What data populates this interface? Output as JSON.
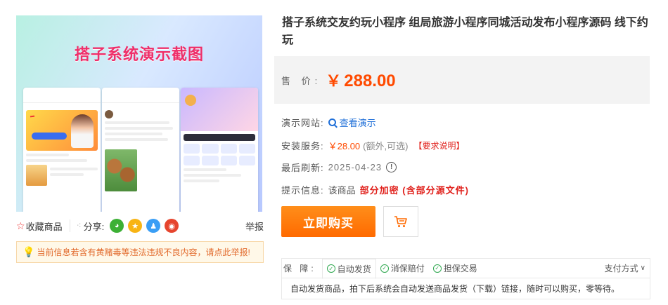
{
  "product_image": {
    "headline": "搭子系统演示截图"
  },
  "left_actions": {
    "favorite_label": "收藏商品",
    "share_label": "分享:",
    "report_label": "举报",
    "share_icons": [
      "wechat-icon",
      "qzone-icon",
      "qq-icon",
      "weibo-icon"
    ]
  },
  "notice": {
    "text": "当前信息若含有黄赌毒等违法违规不良内容，请点此举报!"
  },
  "product": {
    "title": "搭子系统交友约玩小程序 组局旅游小程序同城活动发布小程序源码 线下约玩",
    "price_label": "售 价:",
    "price_symbol": "￥",
    "price_value": "288.00"
  },
  "info": {
    "demo_label": "演示网站:",
    "demo_link": "查看演示",
    "install_label": "安装服务:",
    "install_price": "￥28.00",
    "install_note": "(额外,可选)",
    "install_req": "【要求说明】",
    "refresh_label": "最后刷新:",
    "refresh_date": "2025-04-23",
    "tip_label": "提示信息:",
    "tip_prefix": "该商品",
    "tip_highlight": "部分加密 (含部分源文件)"
  },
  "buttons": {
    "buy_now": "立即购买"
  },
  "guarantee": {
    "label": "保 障:",
    "tabs": [
      "自动发货",
      "消保赔付",
      "担保交易"
    ],
    "payment_label": "支付方式",
    "description": "自动发货商品，拍下后系统会自动发送商品发货（下载）链接，随时可以购买，零等待。"
  },
  "colors": {
    "accent_orange": "#ff6a00",
    "price_red": "#ff4a00",
    "warning_red": "#e0201b",
    "link_blue": "#1f6fd8",
    "check_green": "#2fa84f"
  }
}
